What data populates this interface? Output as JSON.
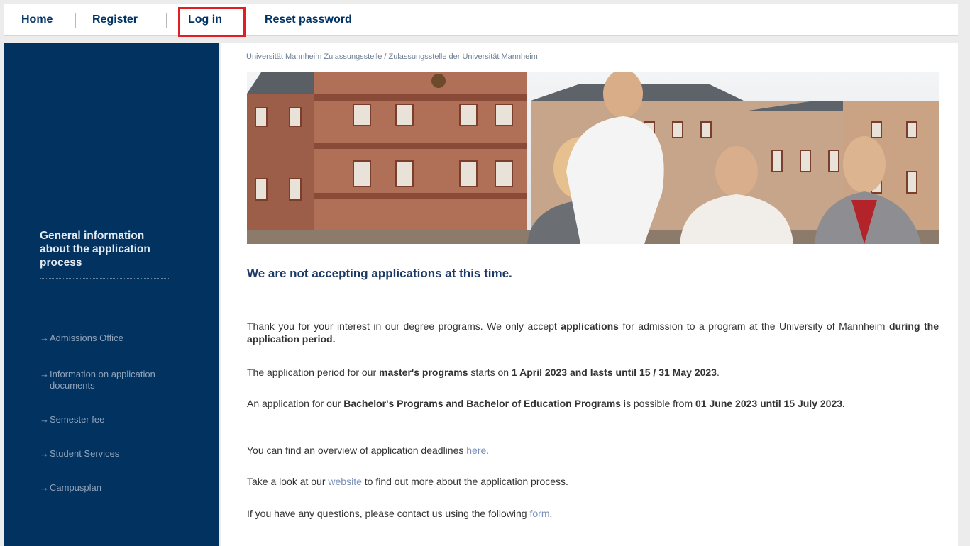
{
  "nav": {
    "home": "Home",
    "register": "Register",
    "login": "Log in",
    "reset": "Reset password"
  },
  "sidebar": {
    "heading": "General information about the application process",
    "links": [
      "Admissions Office",
      "Information on application documents",
      "Semester fee",
      "Student Services",
      "Campusplan"
    ],
    "arrow": "→"
  },
  "breadcrumb": "Universität Mannheim Zulassungsstelle / Zulassungsstelle der Universität Mannheim",
  "main": {
    "heading": "We are not accepting applications at this time.",
    "p1": {
      "t1": "Thank you for your interest in our degree programs. We only accept ",
      "b1": "applications",
      "t2": " for admission to a program at the University of Mannheim ",
      "b2": "during the application period."
    },
    "p2": {
      "t1": "The application period for our ",
      "b1": "master's programs",
      "t2": " starts on ",
      "b2": "1 April 2023 and lasts until 15 / 31 May 2023",
      "t3": "."
    },
    "p3": {
      "t1": "An application for our ",
      "b1": "Bachelor's Programs and Bachelor of Education Programs",
      "t2": " is possible from ",
      "b2": "01 June 2023 until 15 July 2023."
    },
    "p4": {
      "t1": "You can find an overview of application deadlines ",
      "link": "here."
    },
    "p5": {
      "t1": "Take a look at our ",
      "link": "website",
      "t2": " to find out more about the application process."
    },
    "p6": {
      "t1": "If you have any questions, please contact us using the following ",
      "link": "form",
      "t2": "."
    }
  },
  "colors": {
    "sidebar": "#02325f",
    "nav_text": "#003366",
    "highlight": "#e01f24",
    "link": "#7a90b8"
  }
}
